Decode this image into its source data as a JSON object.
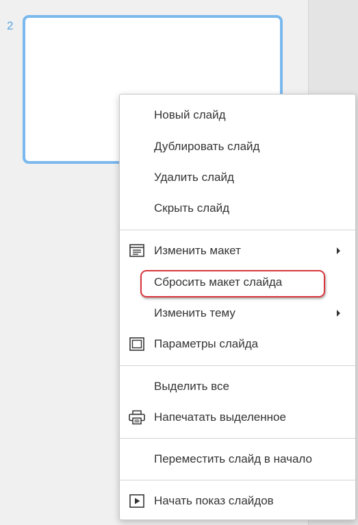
{
  "slide_panel": {
    "slide_number": "2"
  },
  "context_menu": {
    "items": [
      {
        "label": "Новый слайд"
      },
      {
        "label": "Дублировать слайд"
      },
      {
        "label": "Удалить слайд"
      },
      {
        "label": "Скрыть слайд"
      },
      {
        "label": "Изменить макет",
        "icon": "layout-icon",
        "submenu": true
      },
      {
        "label": "Сбросить макет слайда",
        "highlighted": true
      },
      {
        "label": "Изменить тему",
        "submenu": true
      },
      {
        "label": "Параметры слайда",
        "icon": "slide-settings-icon"
      },
      {
        "label": "Выделить все"
      },
      {
        "label": "Напечатать выделенное",
        "icon": "print-icon"
      },
      {
        "label": "Переместить слайд в начало"
      },
      {
        "label": "Начать показ слайдов",
        "icon": "play-icon"
      }
    ]
  },
  "colors": {
    "slide_border": "#7ab8ee",
    "slide_number": "#5aa3e0",
    "highlight_border": "#d9353a"
  }
}
